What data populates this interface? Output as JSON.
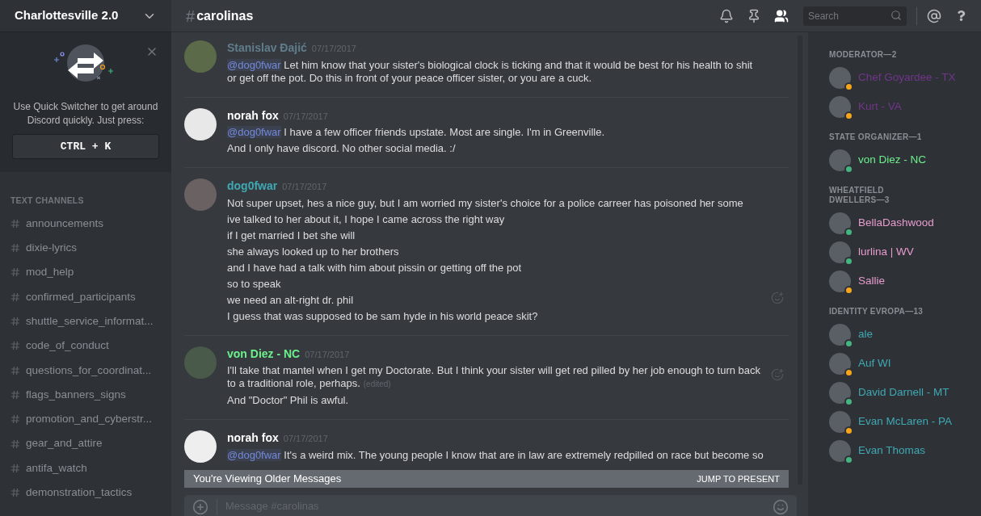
{
  "server": {
    "name": "Charlottesville 2.0"
  },
  "quick_switcher": {
    "text": "Use Quick Switcher to get around Discord quickly. Just press:",
    "shortcut": "CTRL + K"
  },
  "channel_category": "TEXT CHANNELS",
  "channels": [
    {
      "name": "announcements"
    },
    {
      "name": "dixie-lyrics"
    },
    {
      "name": "mod_help"
    },
    {
      "name": "confirmed_participants"
    },
    {
      "name": "shuttle_service_informat..."
    },
    {
      "name": "code_of_conduct"
    },
    {
      "name": "questions_for_coordinat..."
    },
    {
      "name": "flags_banners_signs"
    },
    {
      "name": "promotion_and_cyberstr..."
    },
    {
      "name": "gear_and_attire"
    },
    {
      "name": "antifa_watch"
    },
    {
      "name": "demonstration_tactics"
    }
  ],
  "header": {
    "hash": "#",
    "channel": "carolinas",
    "search_placeholder": "Search",
    "icons": [
      {
        "kind": "bell",
        "selected": false
      },
      {
        "kind": "pin",
        "selected": false
      },
      {
        "kind": "members",
        "selected": true
      }
    ]
  },
  "messages": [
    {
      "author": "Stanislav Đajić",
      "color": "#607d8b",
      "time": "07/17/2017",
      "lines": [
        {
          "mention": "@dog0fwar",
          "text": "Let him know that your sister's biological clock is ticking and that it would be best for his health to shit or get off the pot. Do this in front of your peace officer sister, or you are a cuck."
        }
      ]
    },
    {
      "author": "norah fox",
      "color": "#ffffff",
      "time": "07/17/2017",
      "lines": [
        {
          "mention": "@dog0fwar",
          "text": "I have a few officer friends upstate. Most are single. I'm in Greenville."
        },
        {
          "text": "And I only have discord. No other social media. :/"
        }
      ]
    },
    {
      "author": "dog0fwar",
      "color": "#3fa9b3",
      "time": "07/17/2017",
      "reaction": true,
      "lines": [
        {
          "text": "Not super upset, hes a nice guy, but I am worried my sister's choice for a police carreer has poisoned her some"
        },
        {
          "text": "ive talked to her about it, I hope I came across the right way"
        },
        {
          "text": "if I get married I bet she will"
        },
        {
          "text": "she always looked up to her brothers"
        },
        {
          "text": "and I have had a talk with him about pissin or getting off the pot"
        },
        {
          "text": "so to speak"
        },
        {
          "text": "we need an alt-right dr. phil"
        },
        {
          "text": "I guess that was supposed to be sam hyde in his world peace skit?"
        }
      ]
    },
    {
      "author": "von Diez - NC",
      "color": "#6cf08c",
      "time": "07/17/2017",
      "reaction": true,
      "lines": [
        {
          "text": "I'll take that mantel when I get my Doctorate. But I think your sister will get red pilled by her job enough to turn back to a traditional role, perhaps.",
          "edited": "(edited)"
        },
        {
          "text": "And \"Doctor\" Phil is awful."
        }
      ]
    },
    {
      "author": "norah fox",
      "color": "#ffffff",
      "time": "07/17/2017",
      "lines": [
        {
          "mention": "@dog0fwar",
          "text": "It's a weird mix. The young people I know that are in law are extremely redpilled on race but become so"
        }
      ]
    }
  ],
  "older_banner": {
    "text": "You're Viewing Older Messages",
    "action": "JUMP TO PRESENT"
  },
  "composer": {
    "placeholder": "Message #carolinas"
  },
  "member_groups": [
    {
      "title": "MODERATOR—2",
      "members": [
        {
          "name": "Chef Goyardee - TX",
          "color": "#71368a",
          "idle": true
        },
        {
          "name": "Kurt - VA",
          "color": "#71368a",
          "idle": true
        }
      ]
    },
    {
      "title": "STATE ORGANIZER—1",
      "members": [
        {
          "name": "von Diez - NC",
          "color": "#6cf08c",
          "idle": false
        }
      ]
    },
    {
      "title": "WHEATFIELD DWELLERS—3",
      "members": [
        {
          "name": "BellaDashwood",
          "color": "#e89ccf",
          "idle": false
        },
        {
          "name": "lurlina | WV",
          "color": "#e89ccf",
          "idle": false
        },
        {
          "name": "Sallie",
          "color": "#e89ccf",
          "idle": true
        }
      ]
    },
    {
      "title": "IDENTITY EVROPA—13",
      "members": [
        {
          "name": "ale",
          "color": "#3fa9b3",
          "idle": false
        },
        {
          "name": "Auf WI",
          "color": "#3fa9b3",
          "idle": true
        },
        {
          "name": "David Darnell - MT",
          "color": "#3fa9b3",
          "idle": false
        },
        {
          "name": "Evan McLaren - PA",
          "color": "#3fa9b3",
          "idle": true
        },
        {
          "name": "Evan Thomas",
          "color": "#3fa9b3",
          "idle": false
        }
      ]
    }
  ]
}
